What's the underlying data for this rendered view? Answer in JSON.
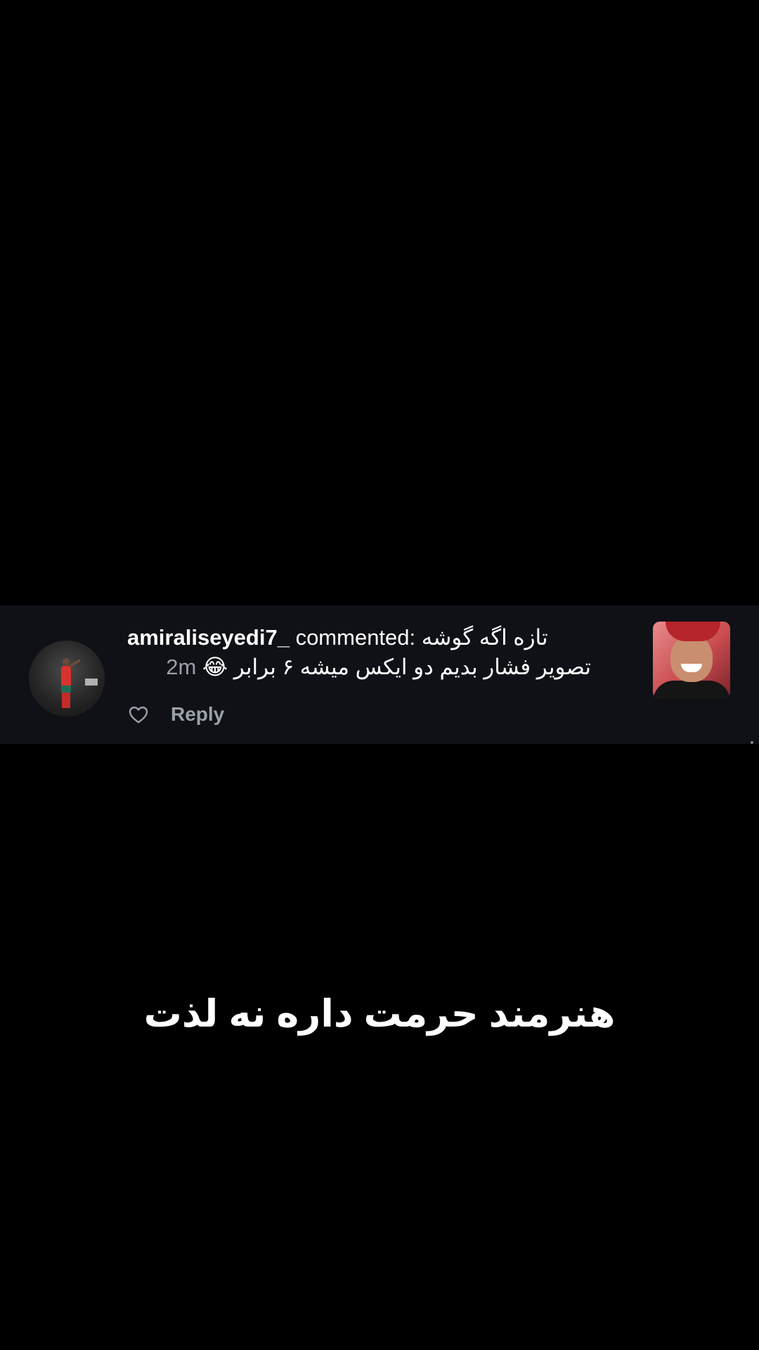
{
  "comment": {
    "username": "amiraliseyedi7_",
    "commented_label": " commented: ",
    "text_line1": "تازه اگه گوشه",
    "text_line2": "تصویر فشار بدیم دو ایکس میشه ۶ برابر",
    "emoji": "😂",
    "time": "2m",
    "reply_label": "Reply",
    "like_icon": "heart-outline-icon"
  },
  "caption": {
    "text": "هنرمند حرمت داره نه لذت"
  },
  "colors": {
    "background": "#000000",
    "card_background": "#0f1116",
    "text_primary": "#ffffff",
    "text_secondary": "#9aa0a8"
  }
}
